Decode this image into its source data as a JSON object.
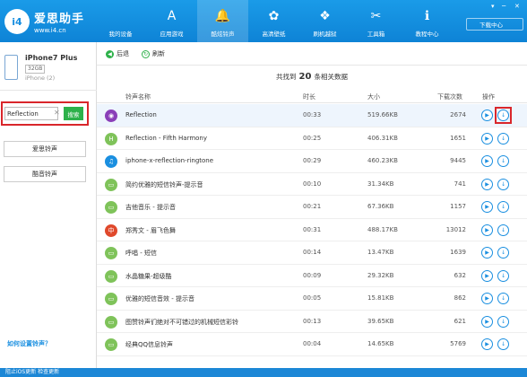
{
  "app": {
    "logo_mark": "i4",
    "logo_title": "爱思助手",
    "logo_url": "www.i4.cn",
    "download_center": "下载中心",
    "window_controls": [
      "▾",
      "─",
      "✕"
    ]
  },
  "nav": [
    {
      "label": "我的设备",
      "icon": "apple-icon",
      "glyph": ""
    },
    {
      "label": "应用游戏",
      "icon": "app-store-icon",
      "glyph": "A"
    },
    {
      "label": "酷炫铃声",
      "icon": "bell-icon",
      "glyph": "🔔"
    },
    {
      "label": "高清壁纸",
      "icon": "flower-icon",
      "glyph": "✿"
    },
    {
      "label": "刷机越狱",
      "icon": "dropbox-icon",
      "glyph": "❖"
    },
    {
      "label": "工具箱",
      "icon": "tools-icon",
      "glyph": "✂"
    },
    {
      "label": "教程中心",
      "icon": "info-icon",
      "glyph": "ℹ"
    }
  ],
  "device": {
    "name": "iPhone7 Plus",
    "capacity": "32GB",
    "model": "iPhone (2)"
  },
  "search": {
    "value": "Reflection",
    "clear": "✕",
    "button": "搜索"
  },
  "sidebar": {
    "hot_ringtones": "爱思铃声",
    "cool_ringtones": "酷音铃声",
    "howto": "如何设置铃声？"
  },
  "toolbar": {
    "back": "后退",
    "refresh": "刷新"
  },
  "summary": {
    "prefix": "共找到",
    "count": "20",
    "suffix": "条相关数据"
  },
  "columns": {
    "name": "铃声名称",
    "duration": "时长",
    "size": "大小",
    "downloads": "下载次数",
    "actions": "操作"
  },
  "rows": [
    {
      "name": "Reflection",
      "duration": "00:33",
      "size": "519.66KB",
      "downloads": "2674",
      "icon_color": "#8a3fb8",
      "glyph": "◉"
    },
    {
      "name": "Reflection - Fifth Harmony",
      "duration": "00:25",
      "size": "406.31KB",
      "downloads": "1651",
      "icon_color": "#7fc35a",
      "glyph": "H"
    },
    {
      "name": "iphone-x-reflection-ringtone",
      "duration": "00:29",
      "size": "460.23KB",
      "downloads": "9445",
      "icon_color": "#1a8fe0",
      "glyph": "♫"
    },
    {
      "name": "简约优雅的短信铃声-提示音",
      "duration": "00:10",
      "size": "31.34KB",
      "downloads": "741",
      "icon_color": "#7fc35a",
      "glyph": "▭"
    },
    {
      "name": "吉他音乐 - 提示音",
      "duration": "00:21",
      "size": "67.36KB",
      "downloads": "1157",
      "icon_color": "#7fc35a",
      "glyph": "▭"
    },
    {
      "name": "郑秀文 - 眉飞色舞",
      "duration": "00:31",
      "size": "488.17KB",
      "downloads": "13012",
      "icon_color": "#e0492c",
      "glyph": "中"
    },
    {
      "name": "呼唱 - 短信",
      "duration": "00:14",
      "size": "13.47KB",
      "downloads": "1639",
      "icon_color": "#7fc35a",
      "glyph": "▭"
    },
    {
      "name": "水晶糖果-超级酷",
      "duration": "00:09",
      "size": "29.32KB",
      "downloads": "632",
      "icon_color": "#7fc35a",
      "glyph": "▭"
    },
    {
      "name": "优雅的短信音效 - 提示音",
      "duration": "00:05",
      "size": "15.81KB",
      "downloads": "862",
      "icon_color": "#7fc35a",
      "glyph": "▭"
    },
    {
      "name": "图赞铃声们绝对不可错过的机械短信彩铃",
      "duration": "00:13",
      "size": "39.65KB",
      "downloads": "621",
      "icon_color": "#7fc35a",
      "glyph": "▭"
    },
    {
      "name": "经典QQ信息铃声",
      "duration": "00:04",
      "size": "14.65KB",
      "downloads": "5769",
      "icon_color": "#7fc35a",
      "glyph": "▭"
    }
  ],
  "status": {
    "text": "阻止iOS更新    检查更新"
  }
}
